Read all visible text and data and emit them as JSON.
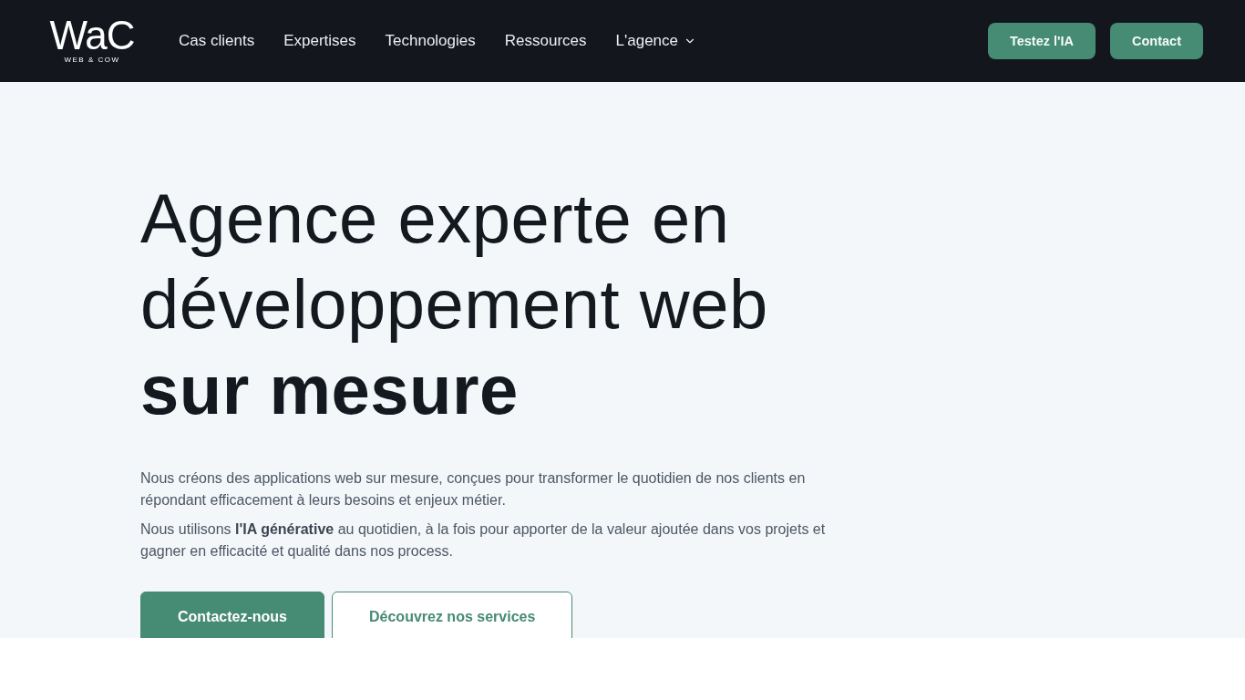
{
  "header": {
    "logo": {
      "mark": "WaC",
      "tagline": "WEB & COW"
    },
    "nav": [
      {
        "label": "Cas clients",
        "has_dropdown": false
      },
      {
        "label": "Expertises",
        "has_dropdown": false
      },
      {
        "label": "Technologies",
        "has_dropdown": false
      },
      {
        "label": "Ressources",
        "has_dropdown": false
      },
      {
        "label": "L'agence",
        "has_dropdown": true
      }
    ],
    "actions": [
      {
        "label": "Testez l'IA"
      },
      {
        "label": "Contact"
      }
    ]
  },
  "hero": {
    "heading": "Agence experte en développement web **sur mesure**",
    "paragraphs": [
      "Nous créons des applications web sur mesure, conçues pour transformer le quotidien de nos clients en répondant efficacement à leurs besoins et enjeux métier.",
      "Nous utilisons **l'IA générative** au quotidien, à la fois pour apporter de la valeur ajoutée dans vos projets et gagner en efficacité et qualité dans nos process."
    ],
    "buttons": [
      {
        "label": "Contactez-nous",
        "kind": "primary"
      },
      {
        "label": "Découvrez nos services",
        "kind": "outline"
      }
    ]
  }
}
